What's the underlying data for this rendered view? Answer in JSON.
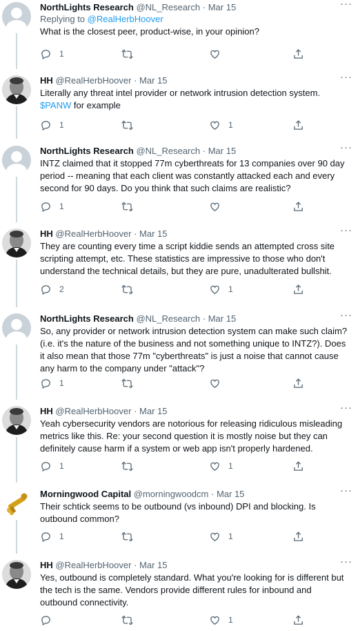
{
  "tweets": [
    {
      "avatar": "default-avatar",
      "name": "NorthLights Research",
      "handle": "@NL_Research",
      "date": "Mar 15",
      "reply_prefix": "Replying to ",
      "reply_handle": "@RealHerbHoover",
      "text": "What is the closest peer, product-wise, in your opinion?",
      "replies": "1",
      "retweets": "",
      "likes": ""
    },
    {
      "avatar": "photo-avatar",
      "name": "HH",
      "handle": "@RealHerbHoover",
      "date": "Mar 15",
      "text": "Literally any threat intel provider or network intrusion detection system.",
      "cashtag": "$PANW",
      "text_after": " for example",
      "replies": "1",
      "retweets": "",
      "likes": "1"
    },
    {
      "avatar": "default-avatar",
      "name": "NorthLights Research",
      "handle": "@NL_Research",
      "date": "Mar 15",
      "text": "INTZ claimed that it stopped 77m cyberthreats for 13 companies over 90 day period -- meaning that each client was constantly attacked each and every second for 90 days. Do you think that such claims are realistic?",
      "replies": "1",
      "retweets": "",
      "likes": ""
    },
    {
      "avatar": "photo-avatar",
      "name": "HH",
      "handle": "@RealHerbHoover",
      "date": "Mar 15",
      "text": "They are counting every time a script kiddie sends an attempted cross site scripting attempt, etc.  These statistics are impressive to those who don't understand the technical details, but they are pure, unadulterated bullshit.",
      "replies": "2",
      "retweets": "",
      "likes": "1"
    },
    {
      "avatar": "default-avatar",
      "name": "NorthLights Research",
      "handle": "@NL_Research",
      "date": "Mar 15",
      "text": "So, any provider or network intrusion detection system can make such claim? (i.e. it's the nature of the business and not something unique to INTZ?). Does it also mean that those 77m \"cyberthreats\" is just a noise that cannot cause any harm to the company under \"attack\"?",
      "replies": "1",
      "retweets": "",
      "likes": ""
    },
    {
      "avatar": "photo-avatar",
      "name": "HH",
      "handle": "@RealHerbHoover",
      "date": "Mar 15",
      "text": "Yeah cybersecurity vendors are notorious for releasing ridiculous misleading metrics like this.  Re: your second question it is mostly noise but they can definitely cause harm if a system or web app isn't properly hardened.",
      "replies": "1",
      "retweets": "",
      "likes": "1"
    },
    {
      "avatar": "morningwood-avatar",
      "name": "Morningwood Capital",
      "handle": "@morningwoodcm",
      "date": "Mar 15",
      "text": "Their schtick seems to be outbound (vs inbound) DPI and blocking. Is outbound common?",
      "replies": "1",
      "retweets": "",
      "likes": "1"
    },
    {
      "avatar": "photo-avatar",
      "name": "HH",
      "handle": "@RealHerbHoover",
      "date": "Mar 15",
      "text": "Yes, outbound is completely standard.  What you're looking for is different but the tech is the same.  Vendors provide different rules for inbound and outbound connectivity.",
      "replies": "",
      "retweets": "",
      "likes": "1"
    }
  ],
  "separator": "·",
  "more_glyph": "···",
  "colors": {
    "accent": "#1d9bf0",
    "secondary_text": "#536471",
    "thread_line": "#cfd9de"
  }
}
